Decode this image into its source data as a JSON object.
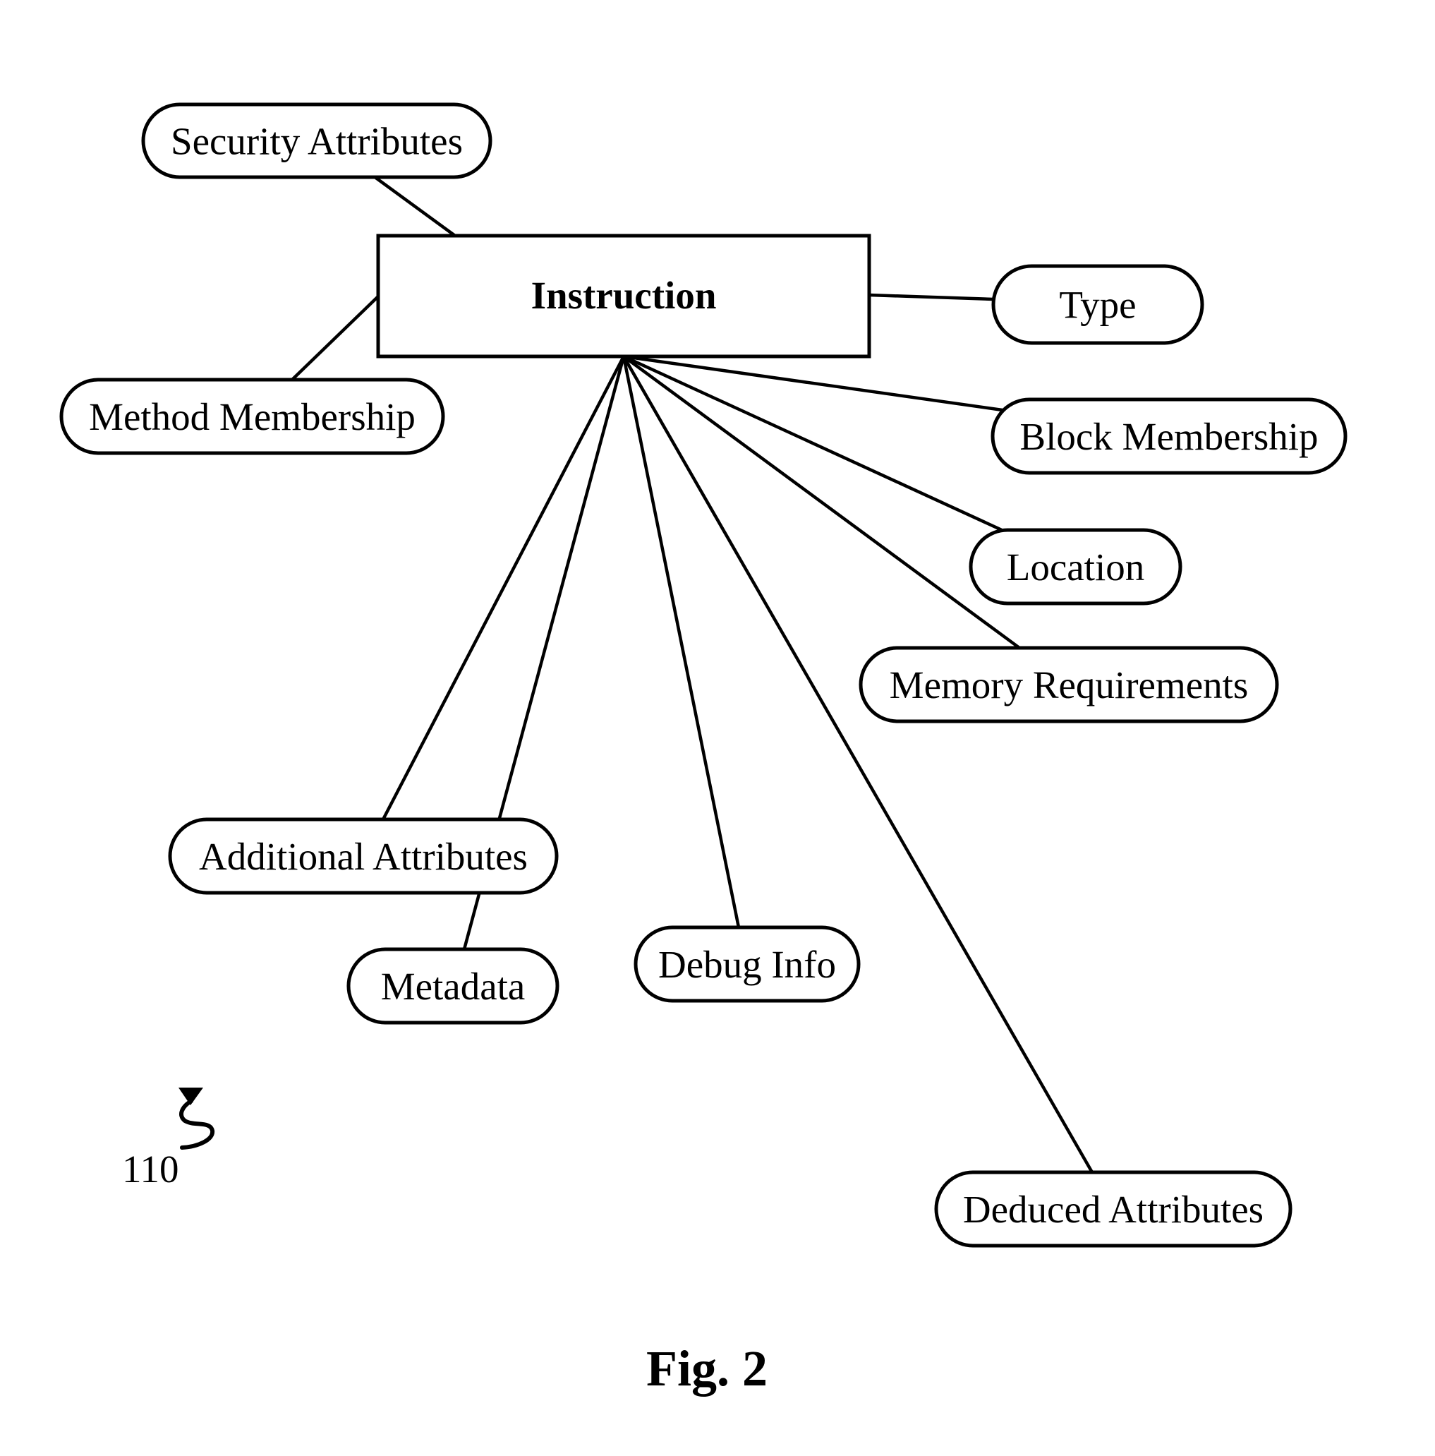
{
  "figure": {
    "caption": "Fig. 2",
    "reference_numeral": "110"
  },
  "central_node": {
    "id": "instruction",
    "label": "Instruction"
  },
  "attribute_nodes": [
    {
      "id": "security-attributes",
      "label": "Security Attributes"
    },
    {
      "id": "method-membership",
      "label": "Method Membership"
    },
    {
      "id": "type",
      "label": "Type"
    },
    {
      "id": "block-membership",
      "label": "Block Membership"
    },
    {
      "id": "location",
      "label": "Location"
    },
    {
      "id": "memory-requirements",
      "label": "Memory Requirements"
    },
    {
      "id": "additional-attributes",
      "label": "Additional Attributes"
    },
    {
      "id": "metadata",
      "label": "Metadata"
    },
    {
      "id": "debug-info",
      "label": "Debug Info"
    },
    {
      "id": "deduced-attributes",
      "label": "Deduced Attributes"
    }
  ],
  "edges": [
    {
      "from": "instruction",
      "to": "security-attributes"
    },
    {
      "from": "instruction",
      "to": "method-membership"
    },
    {
      "from": "instruction",
      "to": "type"
    },
    {
      "from": "instruction",
      "to": "block-membership"
    },
    {
      "from": "instruction",
      "to": "location"
    },
    {
      "from": "instruction",
      "to": "memory-requirements"
    },
    {
      "from": "instruction",
      "to": "additional-attributes"
    },
    {
      "from": "instruction",
      "to": "metadata"
    },
    {
      "from": "instruction",
      "to": "debug-info"
    },
    {
      "from": "instruction",
      "to": "deduced-attributes"
    }
  ]
}
